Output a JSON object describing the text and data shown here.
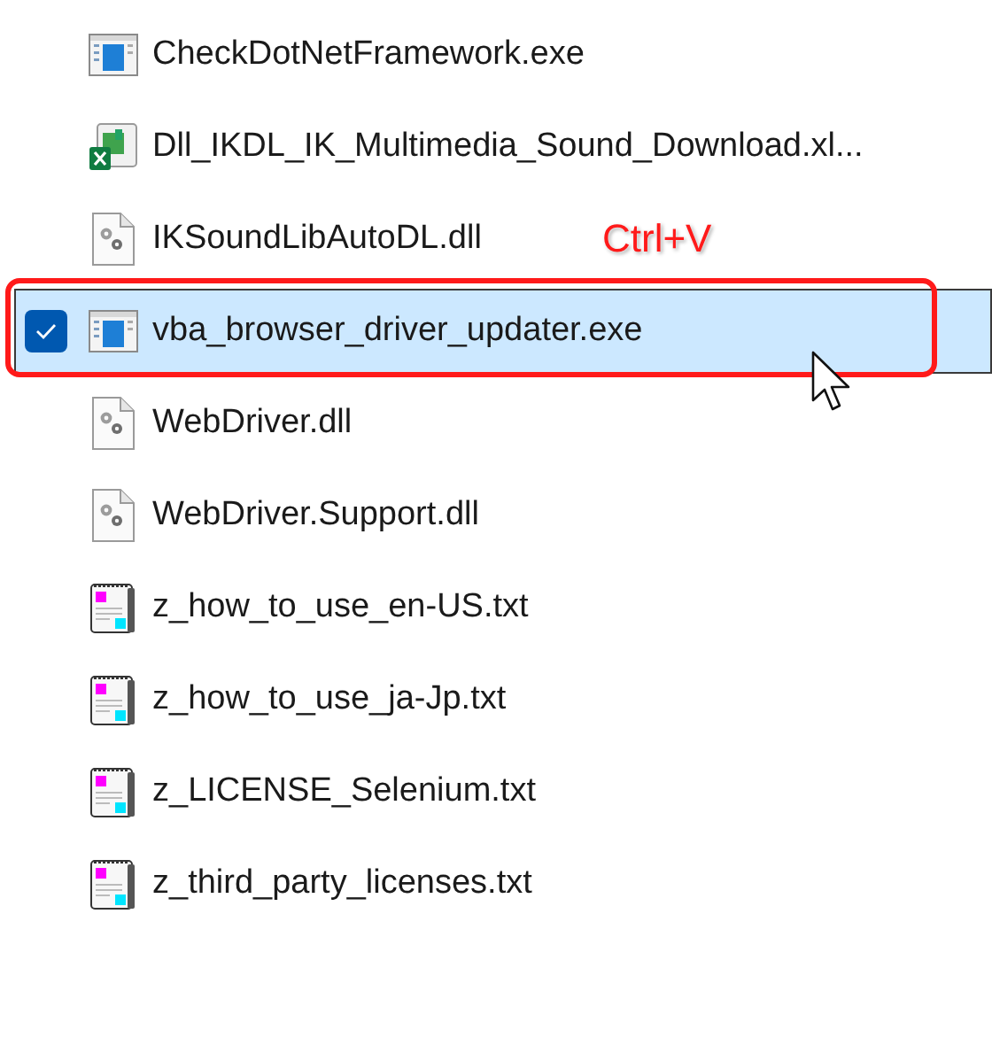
{
  "files": [
    {
      "name": "CheckDotNetFramework.exe",
      "kind": "exe",
      "selected": false
    },
    {
      "name": "Dll_IKDL_IK_Multimedia_Sound_Download.xl...",
      "kind": "excel",
      "selected": false
    },
    {
      "name": "IKSoundLibAutoDL.dll",
      "kind": "dll",
      "selected": false
    },
    {
      "name": "vba_browser_driver_updater.exe",
      "kind": "exe",
      "selected": true
    },
    {
      "name": "WebDriver.dll",
      "kind": "dll",
      "selected": false
    },
    {
      "name": "WebDriver.Support.dll",
      "kind": "dll",
      "selected": false
    },
    {
      "name": "z_how_to_use_en-US.txt",
      "kind": "txt",
      "selected": false
    },
    {
      "name": "z_how_to_use_ja-Jp.txt",
      "kind": "txt",
      "selected": false
    },
    {
      "name": "z_LICENSE_Selenium.txt",
      "kind": "txt",
      "selected": false
    },
    {
      "name": "z_third_party_licenses.txt",
      "kind": "txt",
      "selected": false
    }
  ],
  "annotation": {
    "text": "Ctrl+V"
  }
}
